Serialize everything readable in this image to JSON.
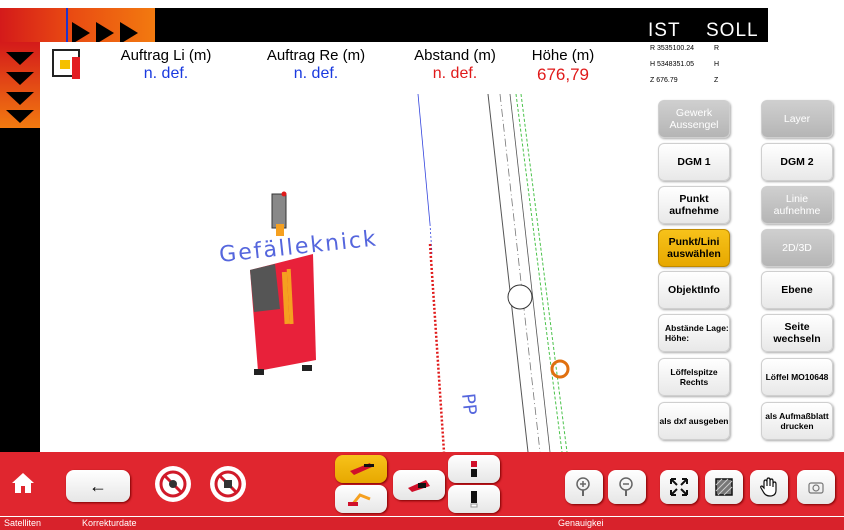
{
  "header": {
    "col1": {
      "label": "Auftrag Li (m)",
      "value": "n. def."
    },
    "col2": {
      "label": "Auftrag Re (m)",
      "value": "n. def."
    },
    "col3": {
      "label": "Abstand (m)",
      "value": "n. def."
    },
    "col4": {
      "label": "Höhe (m)",
      "value": "676,79"
    }
  },
  "coords": {
    "ist_label": "IST",
    "soll_label": "SOLL",
    "ist_r": "R 3535100.24",
    "ist_h": "H 5348351.05",
    "ist_z": "Z 676.79",
    "soll_r": "R",
    "soll_h": "H",
    "soll_z": "Z"
  },
  "map": {
    "annotation_1": "Gefälleknick",
    "annotation_2": "PP"
  },
  "buttons": {
    "gewerk": "Gewerk Aussengel",
    "layer": "Layer",
    "dgm1": "DGM 1",
    "dgm2": "DGM 2",
    "punkt_aufnehmen": "Punkt aufnehme",
    "linie_aufnehmen": "Linie aufnehme",
    "punkt_linie_auswaehlen": "Punkt/Lini auswählen",
    "view_2d3d": "2D/3D",
    "objektinfo": "ObjektInfo",
    "ebene": "Ebene",
    "abstaende": "Abstände Lage: Höhe:",
    "seite_wechseln": "Seite wechseln",
    "loeffelspitze": "Löffelspitze Rechts",
    "loeffel": "Löffel MO10648",
    "dxf": "als dxf ausgeben",
    "aufmassblatt": "als Aufmaßblatt drucken"
  },
  "toolbar": {
    "back_label": "←"
  },
  "status": {
    "satelliten": "Satelliten",
    "korrekturdate": "Korrekturdate",
    "genauigkeit": "Genauigkei"
  },
  "colors": {
    "accent_red": "#e0262f",
    "accent_yellow": "#f2b705",
    "value_blue": "#1a3adf",
    "value_red": "#e01a1a"
  }
}
